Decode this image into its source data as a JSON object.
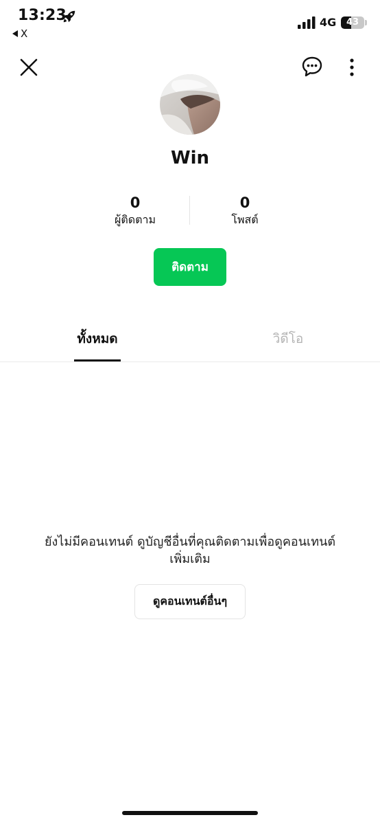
{
  "status_bar": {
    "time": "13:23",
    "back_app": "X",
    "network": "4G",
    "battery_level": 43,
    "battery_text": "43"
  },
  "header": {
    "close_icon": "close-icon",
    "chat_icon": "chat-bubble-icon",
    "more_icon": "more-vertical-icon"
  },
  "profile": {
    "name": "Win",
    "followers_count": "0",
    "followers_label": "ผู้ติดตาม",
    "posts_count": "0",
    "posts_label": "โพสต์",
    "follow_button": "ติดตาม"
  },
  "tabs": [
    {
      "label": "ทั้งหมด",
      "active": true
    },
    {
      "label": "วิดีโอ",
      "active": false
    }
  ],
  "empty_state": {
    "message": "ยังไม่มีคอนเทนต์ ดูบัญชีอื่นที่คุณติดตามเพื่อดูคอนเทนต์เพิ่มเติม",
    "button": "ดูคอนเทนต์อื่นๆ"
  },
  "colors": {
    "accent": "#06c755",
    "inactive_tab": "#b5b5b5"
  }
}
